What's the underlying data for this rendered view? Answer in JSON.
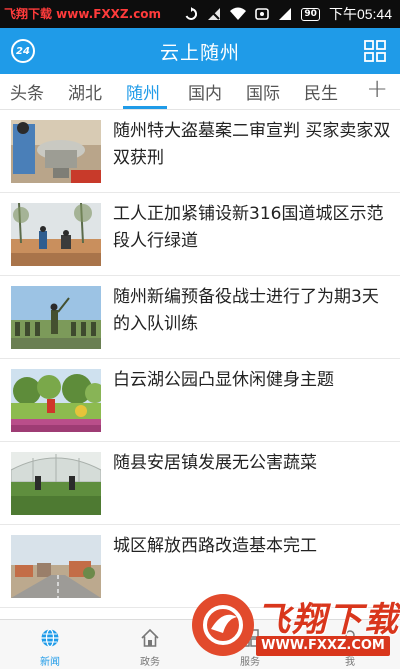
{
  "status_bar": {
    "watermark": "飞翔下载 www.FXXZ.com",
    "battery": "90",
    "time": "下午05:44"
  },
  "header": {
    "title": "云上随州",
    "badge": "24"
  },
  "tabs": [
    {
      "label": "头条"
    },
    {
      "label": "湖北"
    },
    {
      "label": "随州"
    },
    {
      "label": "国内"
    },
    {
      "label": "国际"
    },
    {
      "label": "民生"
    }
  ],
  "active_tab": "随州",
  "tab_add": "+",
  "news": [
    {
      "title": "随州特大盗墓案二审宣判 买家卖家双双获刑"
    },
    {
      "title": "工人正加紧铺设新316国道城区示范段人行绿道"
    },
    {
      "title": "随州新编预备役战士进行了为期3天的入队训练"
    },
    {
      "title": "白云湖公园凸显休闲健身主题"
    },
    {
      "title": "随县安居镇发展无公害蔬菜"
    },
    {
      "title": "城区解放西路改造基本完工"
    }
  ],
  "bottom_nav": [
    {
      "label": "新闻",
      "icon": "globe-icon"
    },
    {
      "label": "政务",
      "icon": "home-icon"
    },
    {
      "label": "服务",
      "icon": "service-icon"
    },
    {
      "label": "我",
      "icon": "user-icon"
    }
  ],
  "overlay_watermark": {
    "brand": "飞翔下载",
    "url": "WWW.FXXZ.COM"
  },
  "colors": {
    "accent": "#1f9be8",
    "watermark_red": "#d9361c"
  }
}
